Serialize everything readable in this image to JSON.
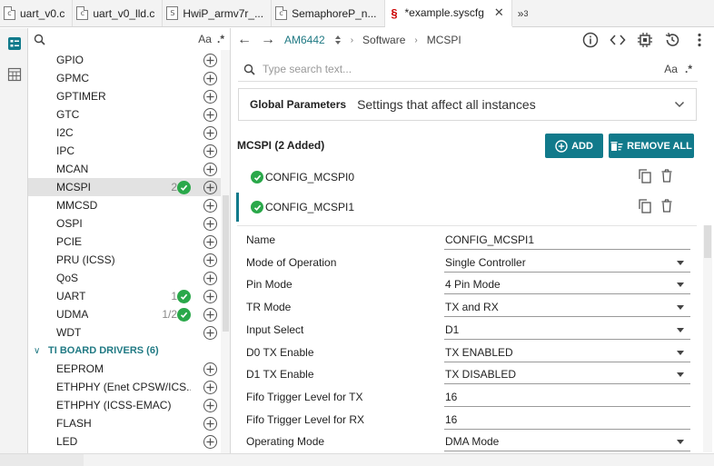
{
  "tabs": [
    {
      "label": "uart_v0.c",
      "icon": "c-file-icon",
      "active": false
    },
    {
      "label": "uart_v0_lld.c",
      "icon": "c-file-icon",
      "active": false
    },
    {
      "label": "HwiP_armv7r_...",
      "icon": "s-file-icon",
      "active": false
    },
    {
      "label": "SemaphoreP_n...",
      "icon": "c-file-icon",
      "active": false
    },
    {
      "label": "*example.syscfg",
      "icon": "syscfg-icon",
      "active": true
    }
  ],
  "tab_overflow": "»",
  "tab_overflow_count": "3",
  "module_search": {
    "placeholder": "",
    "match_case": "Aa",
    "regex": ".*"
  },
  "modules": [
    {
      "name": "GPIO",
      "count": ""
    },
    {
      "name": "GPMC",
      "count": ""
    },
    {
      "name": "GPTIMER",
      "count": ""
    },
    {
      "name": "GTC",
      "count": ""
    },
    {
      "name": "I2C",
      "count": ""
    },
    {
      "name": "IPC",
      "count": ""
    },
    {
      "name": "MCAN",
      "count": ""
    },
    {
      "name": "MCSPI",
      "count": "2",
      "selected": true,
      "checked": true
    },
    {
      "name": "MMCSD",
      "count": ""
    },
    {
      "name": "OSPI",
      "count": ""
    },
    {
      "name": "PCIE",
      "count": ""
    },
    {
      "name": "PRU (ICSS)",
      "count": ""
    },
    {
      "name": "QoS",
      "count": ""
    },
    {
      "name": "UART",
      "count": "1",
      "checked": true
    },
    {
      "name": "UDMA",
      "count": "1/2",
      "checked": true
    },
    {
      "name": "WDT",
      "count": ""
    }
  ],
  "board_group": {
    "label": "TI BOARD DRIVERS (6)"
  },
  "board_modules": [
    {
      "name": "EEPROM"
    },
    {
      "name": "ETHPHY (Enet CPSW/ICS..."
    },
    {
      "name": "ETHPHY (ICSS-EMAC)"
    },
    {
      "name": "FLASH"
    },
    {
      "name": "LED"
    }
  ],
  "toolbar": {
    "device": "AM6442",
    "crumbs": [
      "Software",
      "MCSPI"
    ]
  },
  "search": {
    "placeholder": "Type search text...",
    "value": "",
    "match_case": "Aa",
    "regex": ".*"
  },
  "global": {
    "title": "Global Parameters",
    "description": "Settings that affect all instances"
  },
  "mcspi": {
    "title": "MCSPI (2 Added)",
    "add_label": "ADD",
    "remove_label": "REMOVE ALL",
    "instances": [
      {
        "name": "CONFIG_MCSPI0",
        "active": false
      },
      {
        "name": "CONFIG_MCSPI1",
        "active": true
      }
    ]
  },
  "properties": [
    {
      "label": "Name",
      "value": "CONFIG_MCSPI1",
      "type": "text"
    },
    {
      "label": "Mode of Operation",
      "value": "Single Controller",
      "type": "select"
    },
    {
      "label": "Pin Mode",
      "value": "4 Pin Mode",
      "type": "select"
    },
    {
      "label": "TR Mode",
      "value": "TX and RX",
      "type": "select"
    },
    {
      "label": "Input Select",
      "value": "D1",
      "type": "select"
    },
    {
      "label": "D0 TX Enable",
      "value": "TX ENABLED",
      "type": "select"
    },
    {
      "label": "D1 TX Enable",
      "value": "TX DISABLED",
      "type": "select"
    },
    {
      "label": "Fifo Trigger Level for TX",
      "value": "16",
      "type": "text"
    },
    {
      "label": "Fifo Trigger Level for RX",
      "value": "16",
      "type": "text"
    },
    {
      "label": "Operating Mode",
      "value": "DMA Mode",
      "type": "select"
    }
  ],
  "colors": {
    "accent": "#117a8b",
    "check": "#2aa84a",
    "device": "#217a84"
  }
}
